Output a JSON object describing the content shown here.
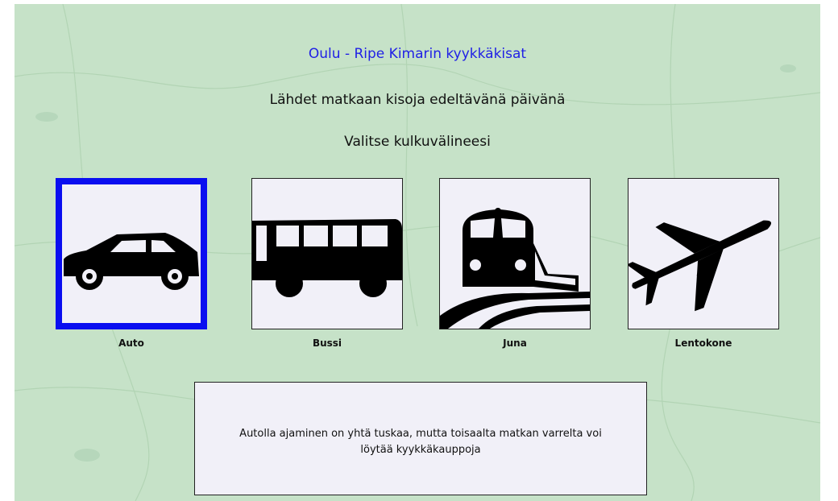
{
  "header": {
    "title": "Oulu - Ripe Kimarin kyykkäkisat",
    "line1": "Lähdet matkaan kisoja edeltävänä päivänä",
    "line2": "Valitse kulkuvälineesi"
  },
  "options": [
    {
      "label": "Auto",
      "icon": "car-icon",
      "selected": true
    },
    {
      "label": "Bussi",
      "icon": "bus-icon",
      "selected": false
    },
    {
      "label": "Juna",
      "icon": "train-icon",
      "selected": false
    },
    {
      "label": "Lentokone",
      "icon": "airplane-icon",
      "selected": false
    }
  ],
  "description": {
    "text": "Autolla ajaminen on yhtä tuskaa, mutta toisaalta matkan varrelta voi löytää kyykkäkauppoja"
  },
  "colors": {
    "background_map": "#c6e2c8",
    "title": "#1f1fe6",
    "selected_border": "#0a0ef0",
    "tile_bg": "#f1f0f8"
  }
}
